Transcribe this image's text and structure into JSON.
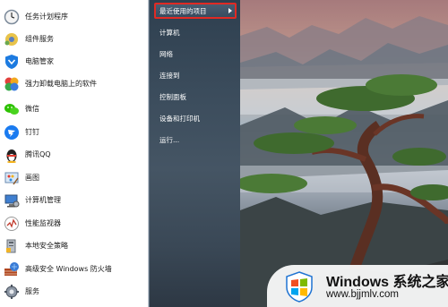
{
  "start_menu": {
    "programs": [
      {
        "label": "任务计划程序",
        "icon": "task-scheduler-icon"
      },
      {
        "label": "组件服务",
        "icon": "component-services-icon"
      },
      {
        "label": "电脑管家",
        "icon": "pc-manager-shield-icon"
      },
      {
        "label": "强力卸载电脑上的软件",
        "icon": "uninstaller-icon"
      },
      {
        "label": "微信",
        "icon": "wechat-icon"
      },
      {
        "label": "钉钉",
        "icon": "dingtalk-icon"
      },
      {
        "label": "腾讯QQ",
        "icon": "qq-penguin-icon"
      },
      {
        "label": "画图",
        "icon": "paint-icon"
      },
      {
        "label": "计算机管理",
        "icon": "computer-management-icon"
      },
      {
        "label": "性能监视器",
        "icon": "performance-monitor-icon"
      },
      {
        "label": "本地安全策略",
        "icon": "local-security-policy-icon"
      },
      {
        "label": "高级安全 Windows 防火墙",
        "icon": "firewall-icon"
      },
      {
        "label": "服务",
        "icon": "services-gear-icon"
      }
    ],
    "places": [
      {
        "label": "最近使用的项目",
        "highlighted": true,
        "has_submenu": true
      },
      {
        "label": "计算机"
      },
      {
        "label": "网络"
      },
      {
        "label": "连接到"
      },
      {
        "label": "控制面板"
      },
      {
        "label": "设备和打印机"
      },
      {
        "label": "运行..."
      }
    ],
    "highlight_color": "#e02a24"
  },
  "watermark": {
    "title": "Windows 系统之家",
    "url": "www.bjjmlv.com"
  }
}
